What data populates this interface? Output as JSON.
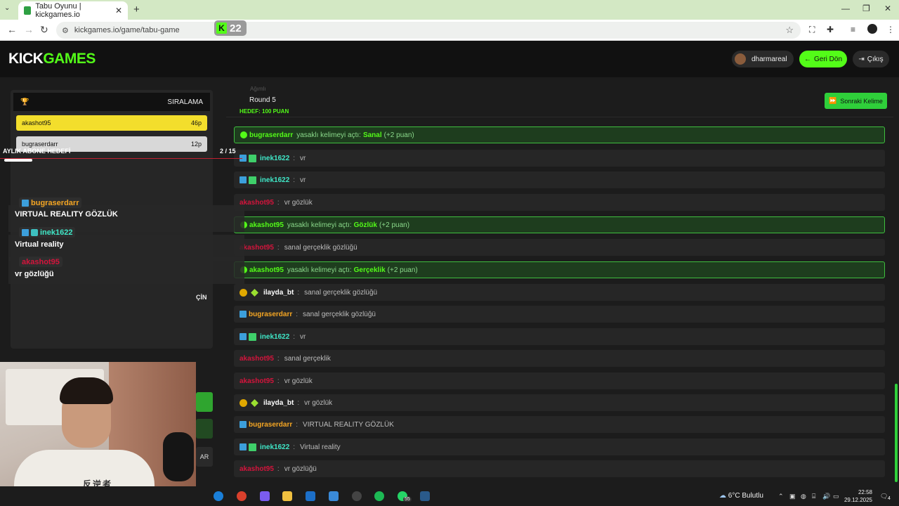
{
  "browser": {
    "tab_title": "Tabu Oyunu | kickgames.io",
    "url": "kickgames.io/game/tabu-game",
    "kick_badge_count": "22"
  },
  "site": {
    "logo_part1": "KICK",
    "logo_part2": "GAMES",
    "username": "dharmareal",
    "back_label": "Geri Dön",
    "logout_label": "Çıkış"
  },
  "ranking": {
    "title": "SIRALAMA",
    "rows": [
      {
        "name": "akashot95",
        "points": "46p"
      },
      {
        "name": "bugraserdarr",
        "points": "12p"
      }
    ]
  },
  "overlay": {
    "ticker": "AYLIK ABONE HEDEFİ",
    "ticker_count": "2 / 15",
    "messages": [
      {
        "user": "bugraserdarr",
        "text": "VIRTUAL REALITY GÖZLÜK"
      },
      {
        "user": "inek1622",
        "text": "Virtual reality"
      },
      {
        "user": "akashot95",
        "text": "vr gözlüğü"
      }
    ]
  },
  "side_panel": {
    "label": "ÇİN",
    "btn3": "AR"
  },
  "webcam": {
    "shirt_text": "反逆者"
  },
  "game": {
    "ghost": "Ağımlı",
    "round": "Round 5",
    "target": "HEDEF: 100 PUAN",
    "next_word": "Sonraki Kelime"
  },
  "chat": [
    {
      "type": "sys",
      "user": "bugraserdarr",
      "pre": "yasaklı kelimeyi açtı:",
      "word": "Sanal",
      "post": "(+2 puan)"
    },
    {
      "type": "msg",
      "user": "inek1622",
      "color": "#3fe7c7",
      "badges": "blue-gift",
      "text": "vr"
    },
    {
      "type": "msg",
      "user": "inek1622",
      "color": "#3fe7c7",
      "badges": "blue-gift",
      "text": "vr"
    },
    {
      "type": "msg",
      "user": "akashot95",
      "color": "#d4143c",
      "badges": "",
      "text": "vr gözlük"
    },
    {
      "type": "sys",
      "user": "akashot95",
      "pre": "yasaklı kelimeyi açtı:",
      "word": "Gözlük",
      "post": "(+2 puan)"
    },
    {
      "type": "msg",
      "user": "akashot95",
      "color": "#d4143c",
      "badges": "",
      "text": "sanal gerçeklik gözlüğü"
    },
    {
      "type": "sys",
      "user": "akashot95",
      "pre": "yasaklı kelimeyi açtı:",
      "word": "Gerçeklik",
      "post": "(+2 puan)"
    },
    {
      "type": "msg",
      "user": "ilayda_bt",
      "color": "#ffffff",
      "badges": "gold-spark",
      "text": "sanal gerçeklik gözlüğü"
    },
    {
      "type": "msg",
      "user": "bugraserdarr",
      "color": "#f5a623",
      "badges": "blue",
      "text": "sanal gerçeklik gözlüğü"
    },
    {
      "type": "msg",
      "user": "inek1622",
      "color": "#3fe7c7",
      "badges": "blue-gift",
      "text": "vr"
    },
    {
      "type": "msg",
      "user": "akashot95",
      "color": "#d4143c",
      "badges": "",
      "text": "sanal gerçeklik"
    },
    {
      "type": "msg",
      "user": "akashot95",
      "color": "#d4143c",
      "badges": "",
      "text": "vr gözlük"
    },
    {
      "type": "msg",
      "user": "ilayda_bt",
      "color": "#ffffff",
      "badges": "gold-spark",
      "text": "vr gözlük"
    },
    {
      "type": "msg",
      "user": "bugraserdarr",
      "color": "#f5a623",
      "badges": "blue",
      "text": "VIRTUAL REALITY GÖZLÜK"
    },
    {
      "type": "msg",
      "user": "inek1622",
      "color": "#3fe7c7",
      "badges": "blue-gift",
      "text": "Virtual reality"
    },
    {
      "type": "msg",
      "user": "akashot95",
      "color": "#d4143c",
      "badges": "",
      "text": "vr gözlüğü"
    }
  ],
  "taskbar": {
    "weather": "6°C Bulutlu",
    "time": "22:58",
    "date": "29.12.2025",
    "whatsapp_badge": "55",
    "notif_count": "4"
  },
  "colors": {
    "accent": "#53fc18",
    "rank1": "#f3de2c",
    "rank2": "#d8d8d8"
  }
}
